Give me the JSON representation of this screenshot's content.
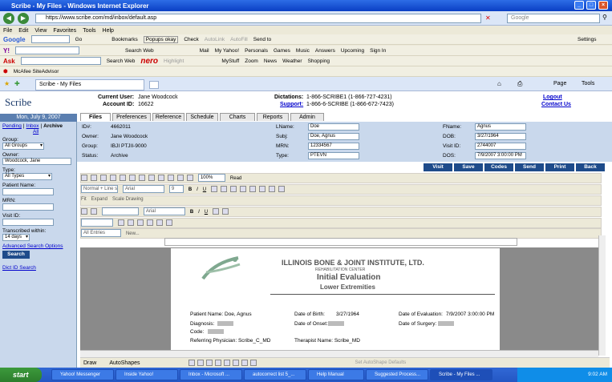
{
  "window": {
    "title": "Scribe - My Files - Windows Internet Explorer"
  },
  "address": {
    "url": "https://www.scribe.com/md/inbox/default.asp",
    "search_placeholder": "Google"
  },
  "menu": [
    "File",
    "Edit",
    "View",
    "Favorites",
    "Tools",
    "Help"
  ],
  "google_bar": {
    "label": "Google",
    "go": "Go",
    "items": [
      "Bookmarks",
      "Popups okay",
      "Check",
      "AutoLink",
      "AutoFill",
      "Send to"
    ],
    "settings": "Settings"
  },
  "yahoo_bar": {
    "items": [
      "Search Web",
      "Mail",
      "My Yahoo!",
      "Personals",
      "Games",
      "Music",
      "Answers",
      "Upcoming",
      "Sign In"
    ]
  },
  "ask_bar": {
    "items": [
      "Search Web",
      "Highlight",
      "MyStuff",
      "Zoom",
      "News",
      "Weather",
      "Shopping"
    ],
    "nero": "nero"
  },
  "mcafee": {
    "label": "McAfee SiteAdvisor"
  },
  "ie_tab": {
    "label": "Scribe - My Files",
    "page": "Page",
    "tools": "Tools"
  },
  "app": {
    "logo": "Scribe",
    "current_user_label": "Current User:",
    "current_user": "Jane Woodcock",
    "account_label": "Account ID:",
    "account_id": "16622",
    "dictations_label": "Dictations:",
    "dictations": "1-866-SCRIBE1 (1-866-727-4231)",
    "support_label": "Support:",
    "support": "1-866-6-SCRIBE (1-866-672-7423)",
    "logout": "Logout",
    "contact": "Contact Us",
    "date": "Mon, July 9, 2007",
    "tabs": [
      "Files",
      "Preferences",
      "Reference",
      "Schedule",
      "Charts",
      "Reports",
      "Admin"
    ],
    "left": {
      "pending": "Pending",
      "sep1": "|",
      "inbox": "Inbox",
      "sep2": "|",
      "archive": "Archive",
      "all": "All",
      "group_label": "Group:",
      "group": "All Groups",
      "owner_label": "Owner:",
      "owner": "Woodcock, Jane",
      "type_label": "Type:",
      "type": "All Types",
      "patient_label": "Patient Name:",
      "mrn_label": "MRN:",
      "visit_label": "Visit ID:",
      "trans_label": "Transcribed within:",
      "trans": "14 days",
      "adv": "Advanced Search Options",
      "search_btn": "Search",
      "dict": "Dict ID Search"
    },
    "info": {
      "id_label": "ID#:",
      "id": "4662011",
      "owner_label": "Owner:",
      "owner": "Jane Woodcock",
      "group_label": "Group:",
      "group": "IBJI PTJII-9000",
      "status_label": "Status:",
      "status": "Archive",
      "lname_label": "LName:",
      "lname": "Doe",
      "subj_label": "Subj:",
      "subj": "Doe, Agnus",
      "mrn_label": "MRN:",
      "mrn": "12334567",
      "type_label": "Type:",
      "type": "PTEVN",
      "fname_label": "FName:",
      "fname": "Agnus",
      "dob_label": "DOB:",
      "dob": "3/27/1964",
      "visit_label": "Visit ID:",
      "visit": "2744007",
      "dos_label": "DOS:",
      "dos": "7/9/2007 3:00:00 PM"
    },
    "actions": [
      "Visit",
      "Save",
      "Codes",
      "Send",
      "Print",
      "Back"
    ],
    "word": {
      "zoom": "100%",
      "read": "Read",
      "style": "Normal + Line s",
      "font": "Arial",
      "size": "9",
      "font2": "Arial",
      "entries": "All Entries",
      "new": "New...",
      "draw": "Draw",
      "autoshapes": "AutoShapes",
      "autoshape_defaults": "Set AutoShape Defaults",
      "fit": "Fit",
      "expand": "Expand",
      "scale": "Scale Drawing"
    },
    "doc": {
      "org": "ILLINOIS BONE & JOINT INSTITUTE, LTD.",
      "sub": "REHABILITATION CENTER",
      "title": "Initial Evaluation",
      "subtitle": "Lower Extremities",
      "patient": "Patient Name: Doe, Agnus",
      "dob_label": "Date of Birth:",
      "dob": "3/27/1964",
      "doe_label": "Date of Evaluation:",
      "doe": "7/9/2007 3:00:00 PM",
      "diag": "Diagnosis:",
      "onset": "Date of Onset:",
      "surgery": "Date of Surgery:",
      "code": "Code:",
      "ref": "Referring Physician:  Scribe_C_MD",
      "ther": "Therapist Name:  Scribe_MD"
    }
  },
  "taskbar": {
    "start": "start",
    "items": [
      "Yahoo! Messenger",
      "Inside Yahoo!",
      "Inbox - Microsoft ...",
      "autocorrect list 5_...",
      "Help Manual",
      "Suggested Process...",
      "Scribe - My Files ..."
    ],
    "time": "9:02 AM"
  }
}
